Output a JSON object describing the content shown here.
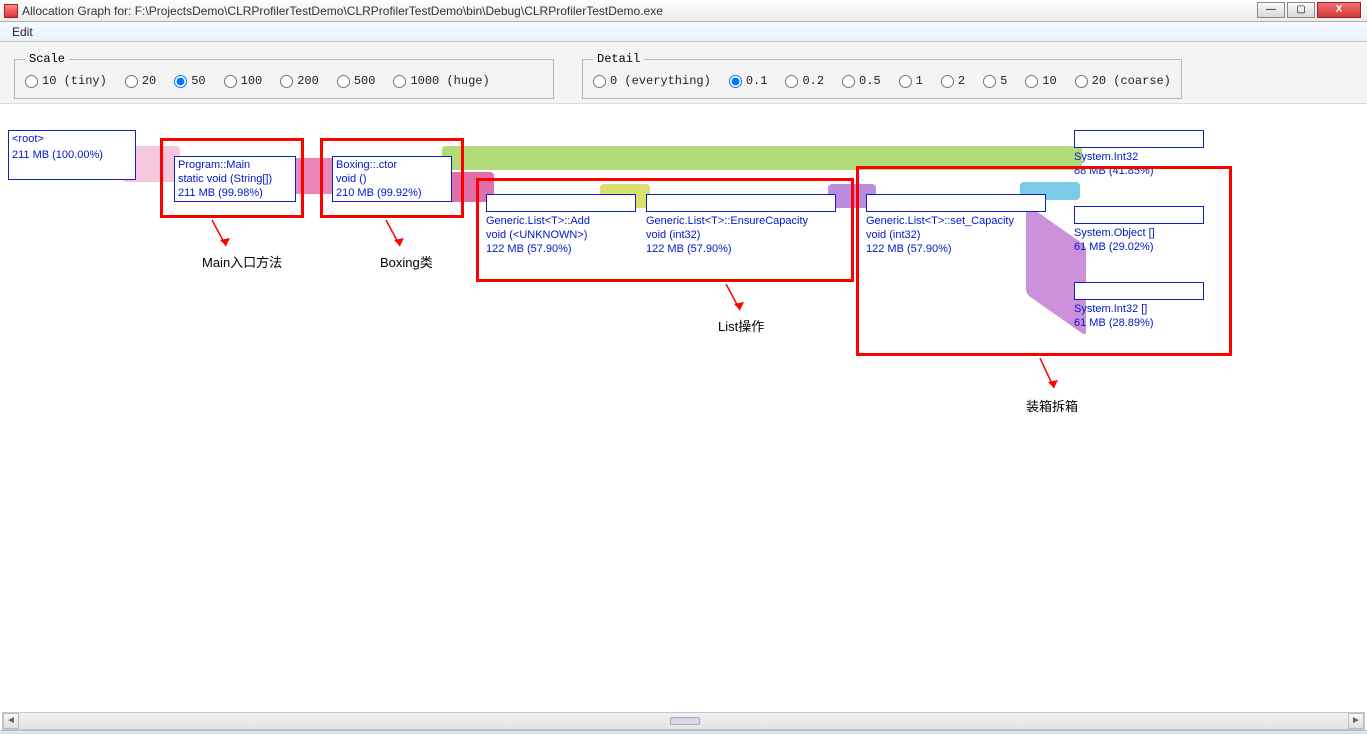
{
  "window": {
    "title": "Allocation Graph for: F:\\ProjectsDemo\\CLRProfilerTestDemo\\CLRProfilerTestDemo\\bin\\Debug\\CLRProfilerTestDemo.exe",
    "min": "—",
    "max": "▢",
    "close": "X"
  },
  "menu": {
    "edit": "Edit"
  },
  "scale": {
    "legend": "Scale",
    "opts": [
      "10 (tiny)",
      "20",
      "50",
      "100",
      "200",
      "500",
      "1000 (huge)"
    ],
    "selected": "50"
  },
  "detail": {
    "legend": "Detail",
    "opts": [
      "0 (everything)",
      "0.1",
      "0.2",
      "0.5",
      "1",
      "2",
      "5",
      "10",
      "20 (coarse)"
    ],
    "selected": "0.1"
  },
  "nodes": {
    "root": {
      "l1": "<root>",
      "l2": "",
      "l3": "211 MB   (100.00%)"
    },
    "main": {
      "l1": "Program::Main",
      "l2": "static void (String[])",
      "l3": "211 MB   (99.98%)"
    },
    "boxing": {
      "l1": "Boxing::.ctor",
      "l2": "void ()",
      "l3": "210 MB   (99.92%)"
    },
    "add": {
      "l1": "Generic.List<T>::Add",
      "l2": "void (<UNKNOWN>)",
      "l3": "122 MB   (57.90%)"
    },
    "ensure": {
      "l1": "Generic.List<T>::EnsureCapacity",
      "l2": "void (int32)",
      "l3": "122 MB   (57.90%)"
    },
    "setcap": {
      "l1": "Generic.List<T>::set_Capacity",
      "l2": "void (int32)",
      "l3": "122 MB   (57.90%)"
    },
    "int32": {
      "l1": "System.Int32",
      "l2": "",
      "l3": "88 MB   (41.85%)"
    },
    "obj": {
      "l1": "System.Object []",
      "l2": "",
      "l3": "61 MB   (29.02%)"
    },
    "int32a": {
      "l1": "System.Int32 []",
      "l2": "",
      "l3": "61 MB   (28.89%)"
    }
  },
  "annotations": {
    "main": "Main入口方法",
    "boxing": "Boxing类",
    "list": "List操作",
    "box": "装箱拆箱"
  }
}
